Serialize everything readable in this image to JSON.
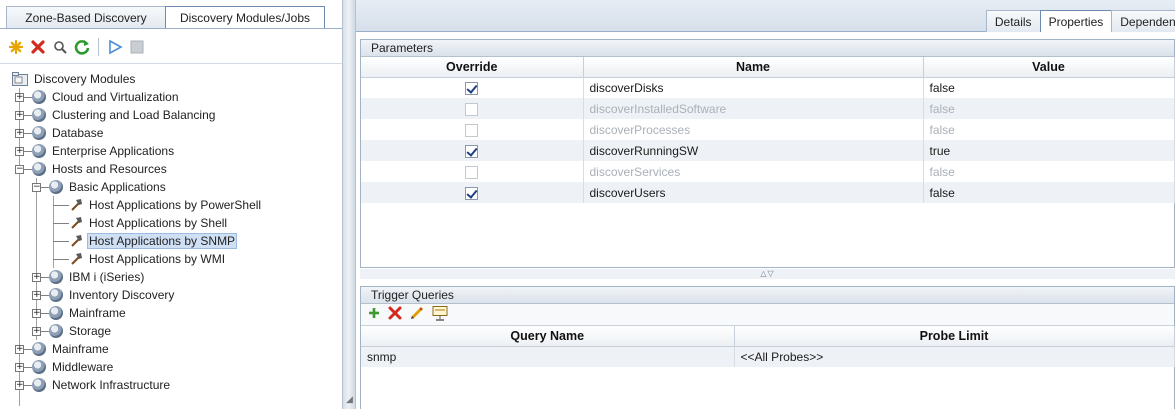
{
  "left_tabs": [
    "Zone-Based Discovery",
    "Discovery Modules/Jobs"
  ],
  "left_active_tab": 1,
  "left_toolbar": {
    "icons": [
      "new-icon",
      "delete-icon",
      "find-icon",
      "refresh-icon",
      "run-icon",
      "stop-icon"
    ]
  },
  "tree": {
    "root": "Discovery Modules",
    "items": [
      "Cloud and Virtualization",
      "Clustering and Load Balancing",
      "Database",
      "Enterprise Applications",
      "Hosts and Resources",
      "Basic Applications",
      "Host Applications by PowerShell",
      "Host Applications by Shell",
      "Host Applications by SNMP",
      "Host Applications by WMI",
      "IBM i (iSeries)",
      "Inventory Discovery",
      "Mainframe",
      "Storage",
      "Mainframe",
      "Middleware",
      "Network Infrastructure"
    ],
    "selected": "Host Applications by SNMP"
  },
  "right_tabs": [
    "Details",
    "Properties",
    "Dependencies"
  ],
  "right_active_tab": 1,
  "parameters": {
    "title": "Parameters",
    "columns": [
      "Override",
      "Name",
      "Value"
    ],
    "rows": [
      {
        "override": true,
        "name": "discoverDisks",
        "value": "false",
        "enabled": true
      },
      {
        "override": false,
        "name": "discoverInstalledSoftware",
        "value": "false",
        "enabled": false
      },
      {
        "override": false,
        "name": "discoverProcesses",
        "value": "false",
        "enabled": false
      },
      {
        "override": true,
        "name": "discoverRunningSW",
        "value": "true",
        "enabled": true
      },
      {
        "override": false,
        "name": "discoverServices",
        "value": "false",
        "enabled": false
      },
      {
        "override": true,
        "name": "discoverUsers",
        "value": "false",
        "enabled": true
      }
    ]
  },
  "trigger_queries": {
    "title": "Trigger Queries",
    "toolbar_icons": [
      "add-icon",
      "remove-icon",
      "edit-icon",
      "preview-icon"
    ],
    "columns": [
      "Query Name",
      "Probe Limit"
    ],
    "rows": [
      {
        "query": "snmp",
        "probe_limit": "<<All Probes>>"
      }
    ]
  }
}
